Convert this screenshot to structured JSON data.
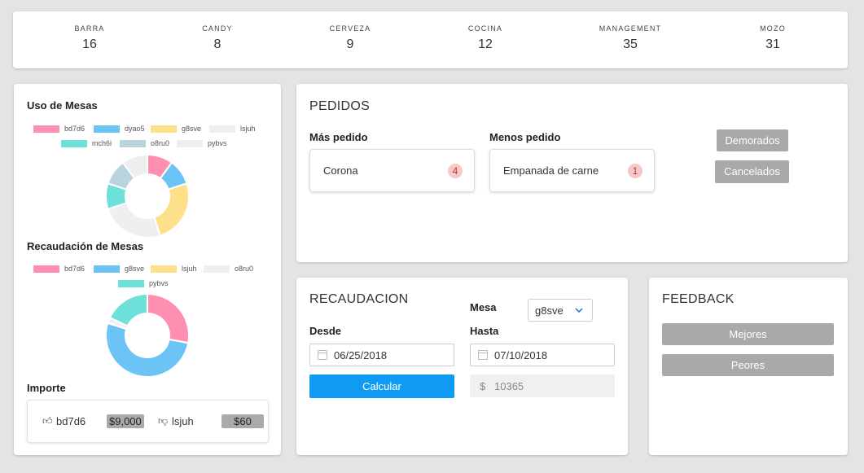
{
  "stats": [
    {
      "label": "BARRA",
      "value": "16"
    },
    {
      "label": "CANDY",
      "value": "8"
    },
    {
      "label": "CERVEZA",
      "value": "9"
    },
    {
      "label": "COCINA",
      "value": "12"
    },
    {
      "label": "MANAGEMENT",
      "value": "35"
    },
    {
      "label": "MOZO",
      "value": "31"
    }
  ],
  "left": {
    "uso_title": "Uso de Mesas",
    "uso_legend": [
      {
        "name": "bd7d6",
        "color": "#ff8fb1"
      },
      {
        "name": "dyao5",
        "color": "#6cc3f5"
      },
      {
        "name": "g8sve",
        "color": "#ffe08a"
      },
      {
        "name": "lsjuh",
        "color": "#efeff1"
      },
      {
        "name": "mch6i",
        "color": "#6ee0da"
      },
      {
        "name": "o8ru0",
        "color": "#b9d3df"
      },
      {
        "name": "pybvs",
        "color": "#eeeeee"
      }
    ],
    "uso_values": [
      2,
      2,
      5,
      5,
      2,
      2,
      2
    ],
    "recaud_title": "Recaudación de Mesas",
    "recaud_legend": [
      {
        "name": "bd7d6",
        "color": "#ff8fb1"
      },
      {
        "name": "g8sve",
        "color": "#6cc3f5"
      },
      {
        "name": "lsjuh",
        "color": "#ffe08a"
      },
      {
        "name": "o8ru0",
        "color": "#efeff1"
      },
      {
        "name": "pybvs",
        "color": "#6ee0da"
      }
    ],
    "recaud_values": [
      28,
      52,
      0.3,
      2,
      18
    ],
    "importe_title": "Importe",
    "importe_best_name": "bd7d6",
    "importe_best_value": "$9,000",
    "importe_worst_name": "lsjuh",
    "importe_worst_value": "$60"
  },
  "pedidos": {
    "title": "PEDIDOS",
    "mas_label": "Más pedido",
    "mas_item": "Corona",
    "mas_count": "4",
    "menos_label": "Menos pedido",
    "menos_item": "Empanada de carne",
    "menos_count": "1",
    "demorados_label": "Demorados",
    "cancelados_label": "Cancelados"
  },
  "recaudacion": {
    "title": "RECAUDACION",
    "mesa_label": "Mesa",
    "mesa_value": "g8sve",
    "desde_label": "Desde",
    "desde_value": "06/25/2018",
    "hasta_label": "Hasta",
    "hasta_value": "07/10/2018",
    "calcular_label": "Calcular",
    "currency": "$",
    "result": "10365"
  },
  "feedback": {
    "title": "FEEDBACK",
    "mejores_label": "Mejores",
    "peores_label": "Peores"
  }
}
